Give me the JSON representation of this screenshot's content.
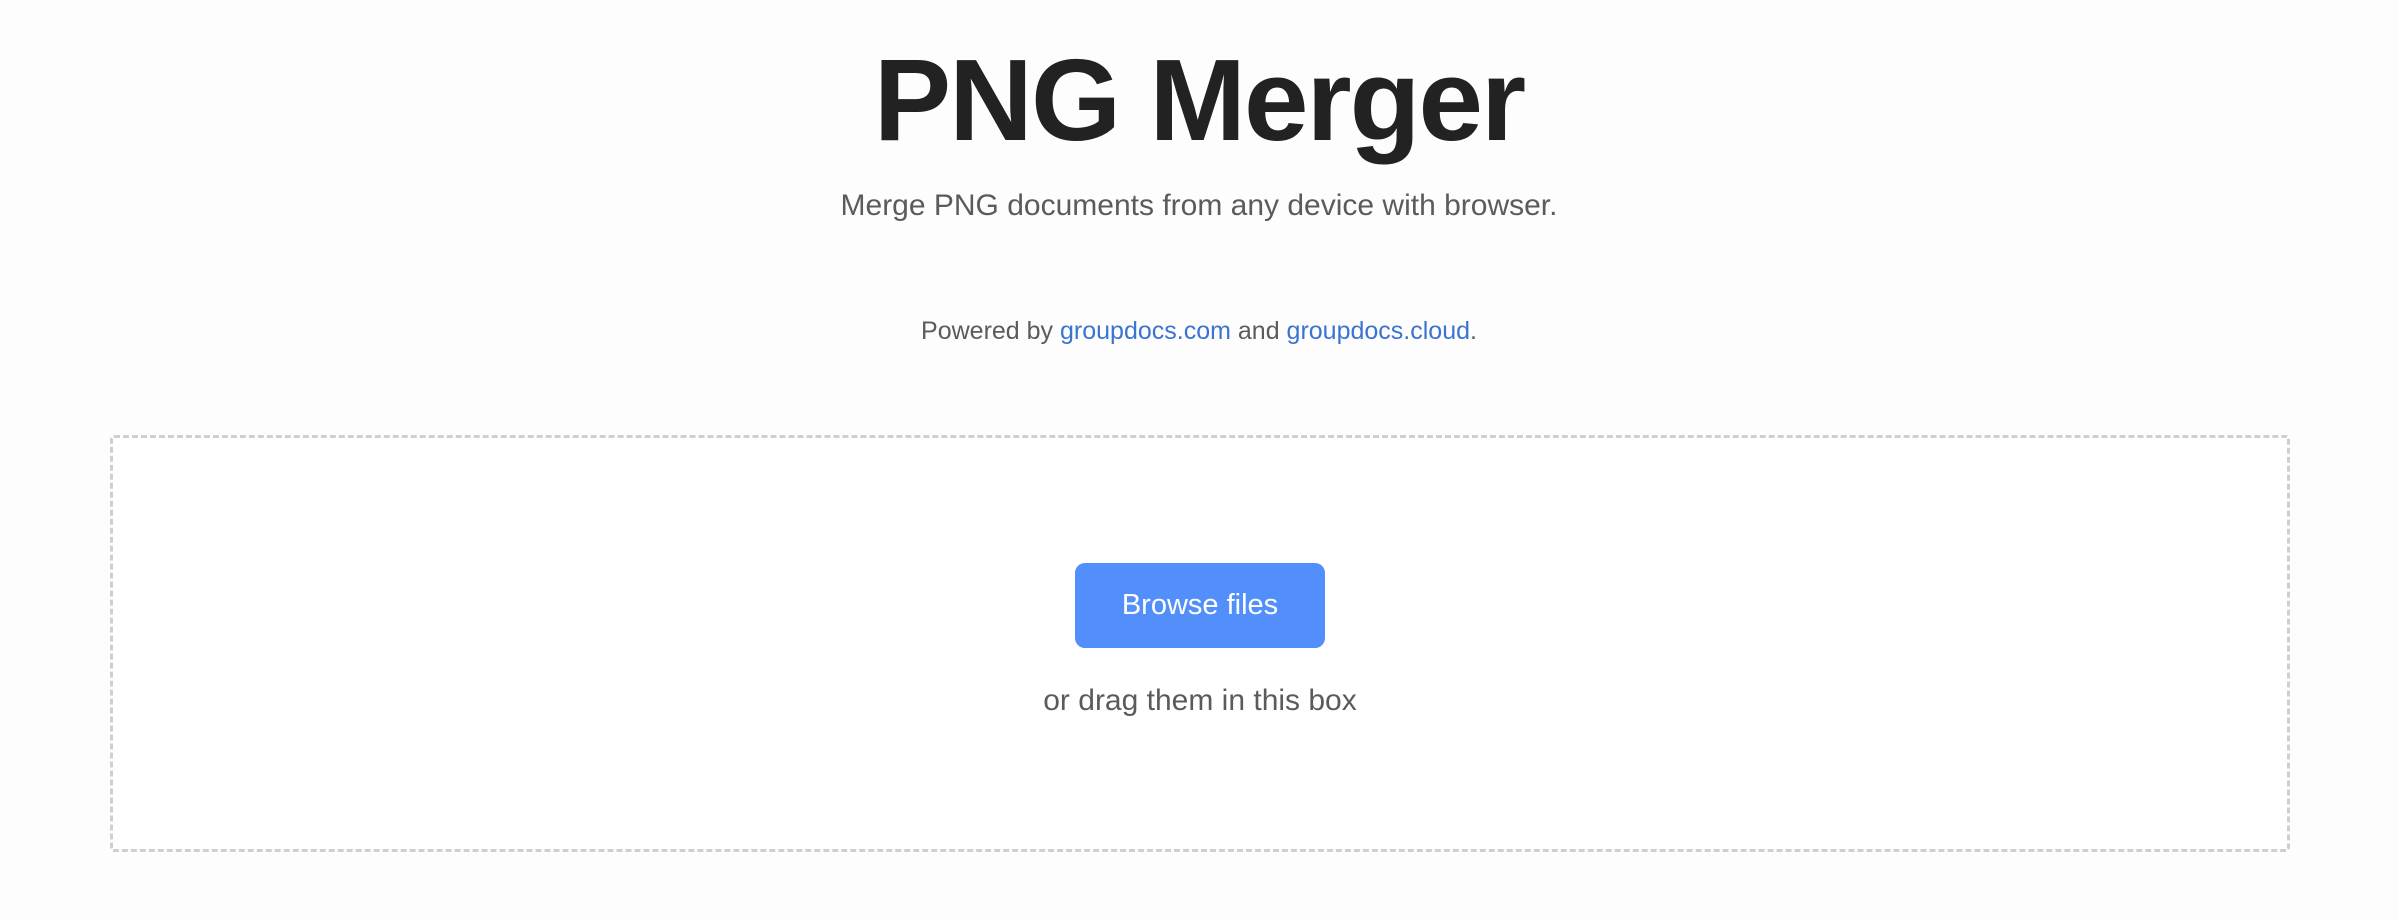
{
  "header": {
    "title": "PNG Merger",
    "subtitle": "Merge PNG documents from any device with browser."
  },
  "powered_by": {
    "prefix": "Powered by ",
    "link1": "groupdocs.com",
    "middle": " and ",
    "link2": "groupdocs.cloud",
    "suffix": "."
  },
  "upload": {
    "browse_label": "Browse files",
    "drag_hint": "or drag them in this box"
  },
  "colors": {
    "accent": "#528ffb",
    "link": "#3b73d1",
    "title": "#222222",
    "muted": "#5b5b5b",
    "border": "#cfcfcf"
  }
}
